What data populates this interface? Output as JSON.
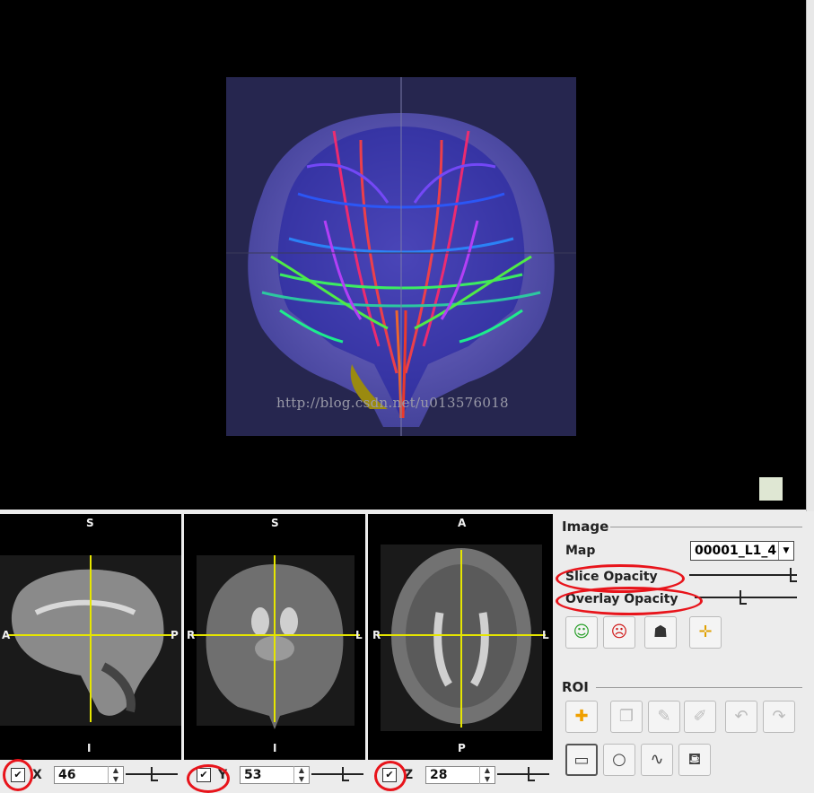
{
  "main_view": {
    "watermark": "http://blog.csdn.net/u013576018"
  },
  "sagittal_view": {
    "top": "S",
    "bottom": "I",
    "left": "A",
    "right": "P"
  },
  "coronal_view": {
    "top": "S",
    "bottom": "I",
    "left": "R",
    "right": "L"
  },
  "axial_view": {
    "top": "A",
    "bottom": "P",
    "left": "R",
    "right": "L"
  },
  "slice_controls": [
    {
      "axis": "X",
      "value": "46",
      "checked": true
    },
    {
      "axis": "Y",
      "value": "53",
      "checked": true
    },
    {
      "axis": "Z",
      "value": "28",
      "checked": true
    }
  ],
  "image_group": {
    "title": "Image",
    "map_label": "Map",
    "map_value": "00001_L1_4",
    "slice_opacity_label": "Slice Opacity",
    "slice_opacity": 1.0,
    "overlay_opacity_label": "Overlay Opacity",
    "overlay_opacity": 0.45,
    "buttons": [
      "add-head-icon",
      "remove-head-icon",
      "head-shadow-icon",
      "crosshair-box-icon"
    ]
  },
  "roi_group": {
    "title": "ROI",
    "buttons_row1": [
      "new-roi-icon",
      "duplicate-roi-icon",
      "brush-icon",
      "eraser-icon",
      "undo-icon",
      "redo-icon"
    ],
    "buttons_row2": [
      "rectangle-tool-icon",
      "circle-tool-icon",
      "freehand-tool-icon",
      "fill-tool-icon"
    ]
  },
  "colors": {
    "crosshair": "#e6e600",
    "annotation": "#e8141b",
    "background": "#000000"
  }
}
